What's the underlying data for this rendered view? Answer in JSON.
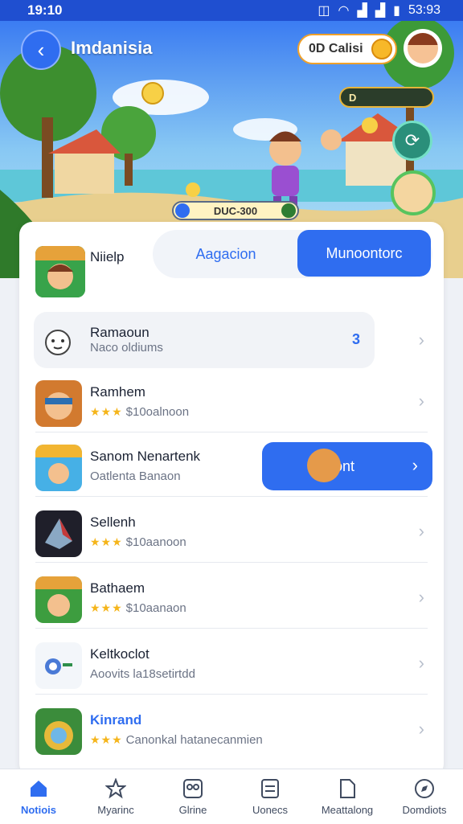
{
  "status": {
    "time": "19:10",
    "right": "53:93"
  },
  "header": {
    "title": "Imdanisia",
    "coin_label": "0D Calisi"
  },
  "hero": {
    "level_badge": "D",
    "score": "DUC-300"
  },
  "featured": {
    "label": "Niielp"
  },
  "segments": [
    {
      "label": "Aagacion"
    },
    {
      "label": "Munoontorc"
    }
  ],
  "search": {
    "name": "Ramaoun",
    "sub": "Naco oldiums",
    "count": "3"
  },
  "rows": [
    {
      "name": "Ramhem",
      "stars": "★★★",
      "sub": "$10oalnoon"
    },
    {
      "name": "Sanom Nenartenk",
      "stars": "",
      "sub": "Oatlenta Banaon"
    },
    {
      "name": "Sellenh",
      "stars": "★★★",
      "sub": "$10aanoon"
    },
    {
      "name": "Bathaem",
      "stars": "★★★",
      "sub": "$10aanaon"
    },
    {
      "name": "Keltkoclot",
      "stars": "",
      "sub": "Aoovits la18setirtdd"
    },
    {
      "name": "Kinrand",
      "stars": "★★★",
      "sub": "Canonkal hatanecanmien"
    }
  ],
  "launch": {
    "label": "Lbont"
  },
  "tabs": [
    {
      "label": "Notiois",
      "icon": "home-icon"
    },
    {
      "label": "Myarinc",
      "icon": "star-icon"
    },
    {
      "label": "Glrine",
      "icon": "grid-icon"
    },
    {
      "label": "Uonecs",
      "icon": "list-icon"
    },
    {
      "label": "Meattalong",
      "icon": "document-icon"
    },
    {
      "label": "Domdiots",
      "icon": "compass-icon"
    }
  ],
  "colors": {
    "accent": "#2f6df0",
    "status_bar": "#1f4fd0",
    "star": "#f5b51b"
  }
}
